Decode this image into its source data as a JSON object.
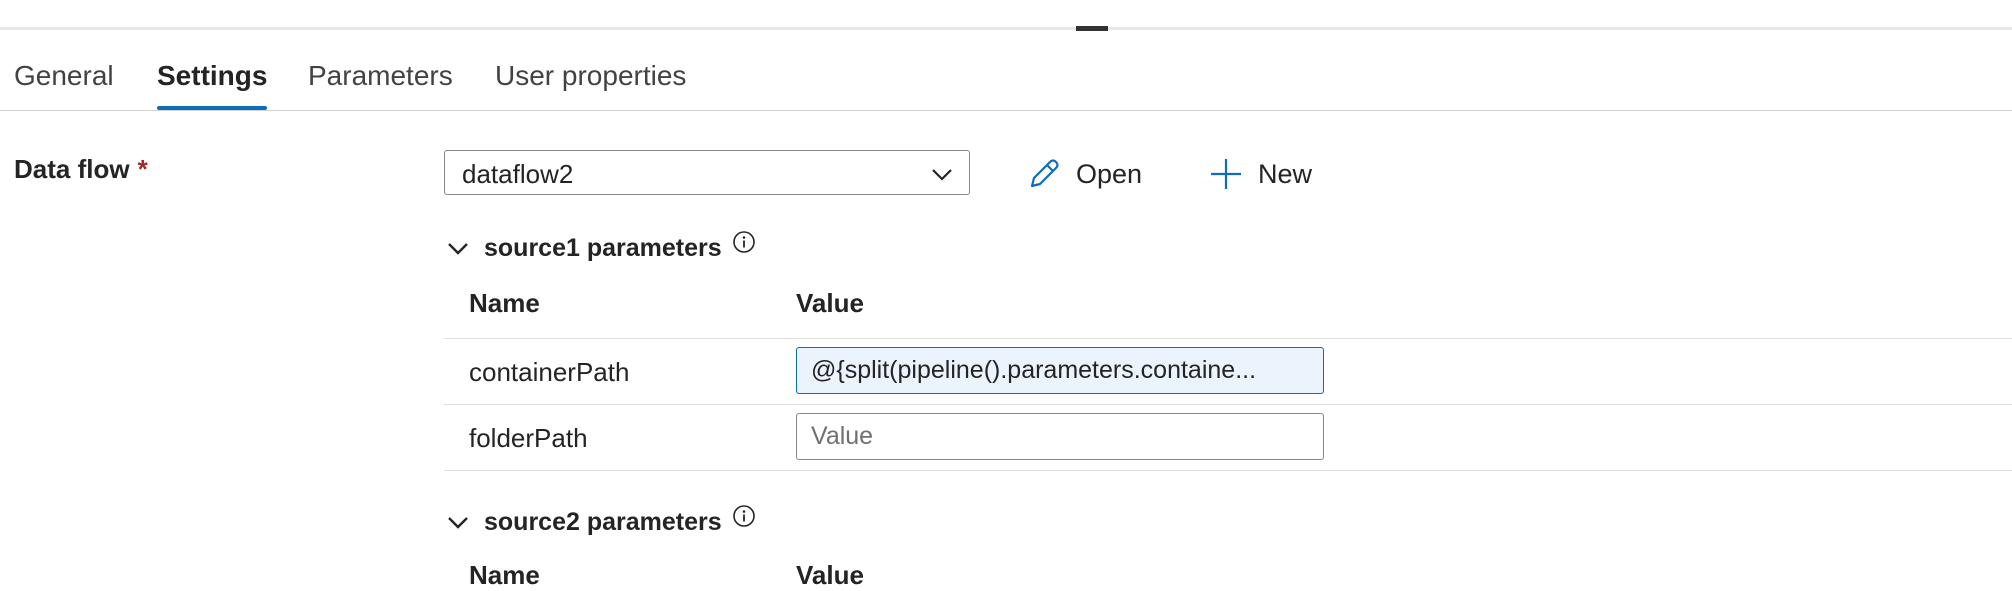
{
  "tabs": [
    {
      "label": "General",
      "active": false
    },
    {
      "label": "Settings",
      "active": true
    },
    {
      "label": "Parameters",
      "active": false
    },
    {
      "label": "User properties",
      "active": false
    }
  ],
  "data_flow": {
    "label": "Data flow",
    "required_marker": "*",
    "selected": "dataflow2",
    "open_label": "Open",
    "new_label": "New"
  },
  "sections": [
    {
      "title": "source1 parameters",
      "columns": {
        "name": "Name",
        "value": "Value"
      },
      "rows": [
        {
          "name": "containerPath",
          "value": "@{split(pipeline().parameters.containe...",
          "placeholder": "Value"
        },
        {
          "name": "folderPath",
          "value": "",
          "placeholder": "Value"
        }
      ]
    },
    {
      "title": "source2 parameters",
      "columns": {
        "name": "Name",
        "value": "Value"
      }
    }
  ],
  "colors": {
    "accent": "#0f6cbd",
    "required": "#a4262c",
    "input_fill": "#ebf3fc"
  }
}
